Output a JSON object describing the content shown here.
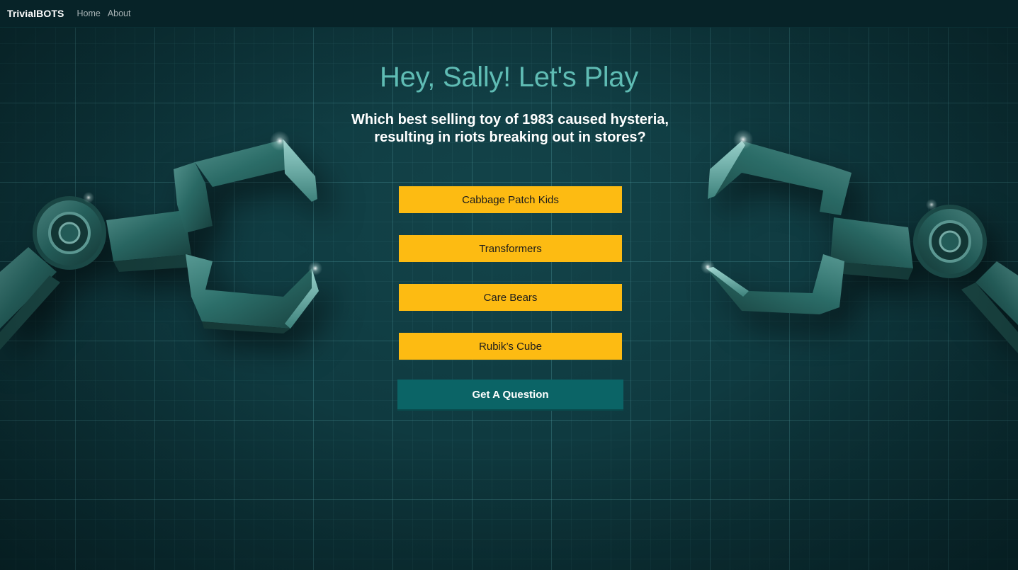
{
  "navbar": {
    "brand": "TrivialBOTS",
    "links": [
      {
        "label": "Home"
      },
      {
        "label": "About"
      }
    ]
  },
  "main": {
    "greeting": "Hey, Sally! Let's Play",
    "question": "Which best selling toy of 1983 caused hysteria, resulting in riots breaking out in stores?",
    "answers": [
      {
        "label": "Cabbage Patch Kids"
      },
      {
        "label": "Transformers"
      },
      {
        "label": "Care Bears"
      },
      {
        "label": "Rubik’s Cube"
      }
    ],
    "get_question_label": "Get A Question"
  },
  "colors": {
    "background": "#0d2e33",
    "navbar": "#072328",
    "title": "#5fbcb4",
    "answer_button": "#fdbb12",
    "action_button": "#0b6466",
    "claw": "#2a6b66"
  }
}
